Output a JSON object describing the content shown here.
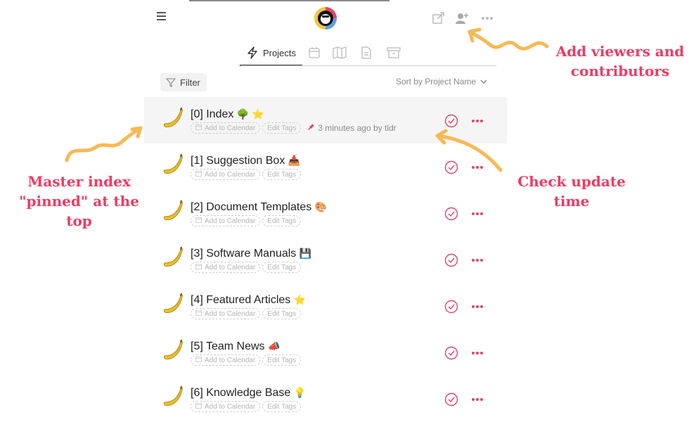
{
  "header": {
    "menu_icon": "hamburger-icon",
    "logo_icon": "coin-logo",
    "action_icons": [
      "share-icon",
      "add-user-icon",
      "more-icon"
    ]
  },
  "tabs": [
    {
      "label": "Projects",
      "icon": "lightning-icon",
      "active": true
    },
    {
      "label": "",
      "icon": "calendar-icon"
    },
    {
      "label": "",
      "icon": "map-icon"
    },
    {
      "label": "",
      "icon": "document-icon"
    },
    {
      "label": "",
      "icon": "archive-icon"
    }
  ],
  "toolbar": {
    "filter_label": "Filter",
    "sort_label": "Sort by Project Name"
  },
  "projects": [
    {
      "title": "[0] Index",
      "emoji": "🌳 ⭐",
      "pinned": true,
      "updated": "3 minutes ago by tldr"
    },
    {
      "title": "[1] Suggestion Box",
      "emoji": "📥"
    },
    {
      "title": "[2] Document Templates",
      "emoji": "🎨"
    },
    {
      "title": "[3] Software Manuals",
      "emoji": "💾"
    },
    {
      "title": "[4] Featured Articles",
      "emoji": "⭐"
    },
    {
      "title": "[5] Team News",
      "emoji": "📣"
    },
    {
      "title": "[6] Knowledge Base",
      "emoji": "💡"
    }
  ],
  "chips": {
    "calendar": "Add to Calendar",
    "tags": "Edit Tags"
  },
  "annotations": {
    "viewers_line1": "Add viewers and",
    "viewers_line2": "contributors",
    "index_line1": "Master index",
    "index_line2": "\"pinned\" at the top",
    "update": "Check update time"
  },
  "colors": {
    "accent": "#ef3b62",
    "arrow": "#f7b955",
    "row_highlight": "#f5f5f5"
  }
}
